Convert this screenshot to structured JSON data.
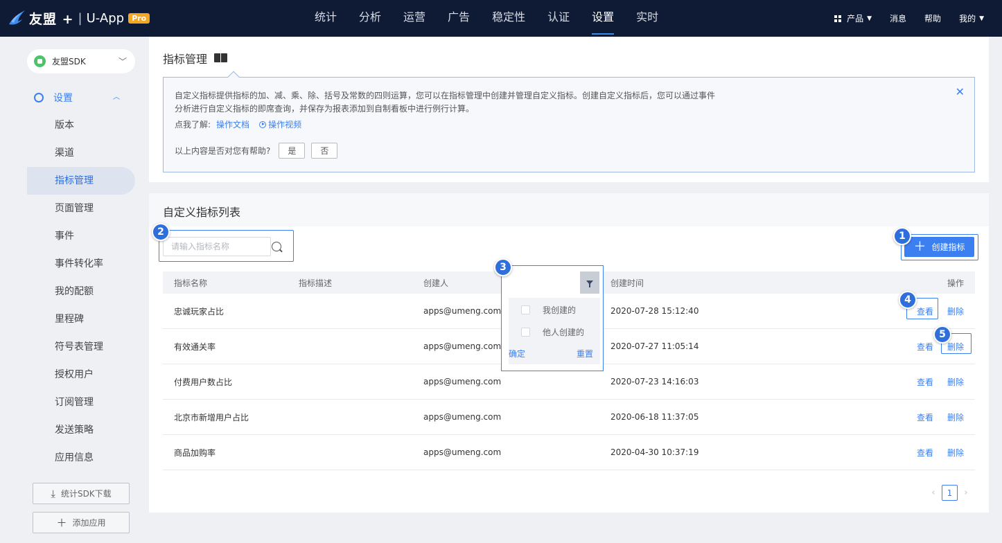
{
  "header": {
    "brand": "友盟 +",
    "separator": "|",
    "app": "U-App",
    "badge": "Pro",
    "nav": [
      "统计",
      "分析",
      "运营",
      "广告",
      "稳定性",
      "认证",
      "设置",
      "实时"
    ],
    "active_nav": "设置",
    "right": {
      "product": "产品",
      "messages": "消息",
      "help": "帮助",
      "mine": "我的"
    }
  },
  "sidebar": {
    "app_selector": "友盟SDK",
    "section": "设置",
    "items": [
      "版本",
      "渠道",
      "指标管理",
      "页面管理",
      "事件",
      "事件转化率",
      "我的配额",
      "里程碑",
      "符号表管理",
      "授权用户",
      "订阅管理",
      "发送策略",
      "应用信息"
    ],
    "active_item": "指标管理",
    "download_btn": "统计SDK下载",
    "add_app_btn": "添加应用"
  },
  "info": {
    "title": "指标管理",
    "text": "自定义指标提供指标的加、减、乘、除、括号及常数的四则运算，您可以在指标管理中创建并管理自定义指标。创建自定义指标后，您可以通过事件分析进行自定义指标的即席查询，并保存为报表添加到自制看板中进行例行计算。",
    "learn_prefix": "点我了解:",
    "doc_link": "操作文档",
    "video_link": "操作视频",
    "helpful_q": "以上内容是否对您有帮助?",
    "yes": "是",
    "no": "否"
  },
  "list": {
    "title": "自定义指标列表",
    "search_placeholder": "请输入指标名称",
    "create_btn": "创建指标",
    "columns": {
      "name": "指标名称",
      "desc": "指标描述",
      "creator": "创建人",
      "time": "创建时间",
      "ops": "操作"
    },
    "rows": [
      {
        "name": "忠诚玩家占比",
        "desc": "",
        "creator": "apps@umeng.com",
        "time": "2020-07-28 15:12:40"
      },
      {
        "name": "有效通关率",
        "desc": "",
        "creator": "apps@umeng.com",
        "time": "2020-07-27 11:05:14"
      },
      {
        "name": "付费用户数占比",
        "desc": "",
        "creator": "apps@umeng.com",
        "time": "2020-07-23 14:16:03"
      },
      {
        "name": "北京市新增用户占比",
        "desc": "",
        "creator": "apps@umeng.com",
        "time": "2020-06-18 11:37:05"
      },
      {
        "name": "商品加购率",
        "desc": "",
        "creator": "apps@umeng.com",
        "time": "2020-04-30 10:37:19"
      }
    ],
    "op_view": "查看",
    "op_delete": "删除",
    "filter": {
      "opt1": "我创建的",
      "opt2": "他人创建的",
      "confirm": "确定",
      "reset": "重置"
    },
    "page": "1"
  },
  "badges": [
    "1",
    "2",
    "3",
    "4",
    "5"
  ],
  "colors": {
    "topbar": "#0f1b35",
    "accent": "#3c7ff0",
    "pro": "#f5a623"
  }
}
